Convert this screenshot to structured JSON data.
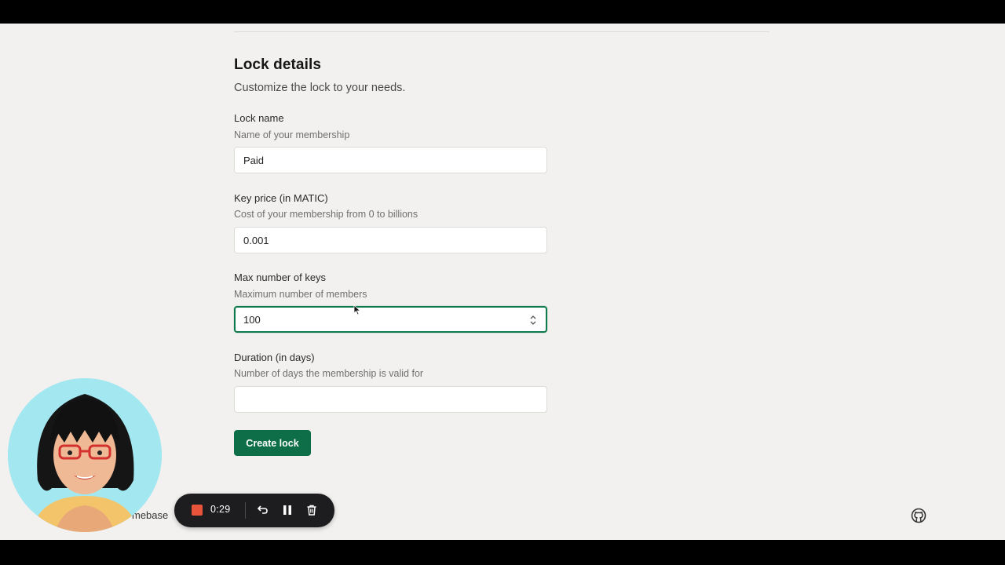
{
  "section": {
    "title": "Lock details",
    "subtitle": "Customize the lock to your needs."
  },
  "fields": {
    "lock_name": {
      "label": "Lock name",
      "help": "Name of your membership",
      "value": "Paid"
    },
    "key_price": {
      "label": "Key price (in MATIC)",
      "help": "Cost of your membership from 0 to billions",
      "value": "0.001"
    },
    "max_keys": {
      "label": "Max number of keys",
      "help": "Maximum number of members",
      "value": "100"
    },
    "duration": {
      "label": "Duration (in days)",
      "help": "Number of days the membership is valid for",
      "value": ""
    }
  },
  "actions": {
    "create_label": "Create lock"
  },
  "footer": {
    "left_text": "mebase"
  },
  "recorder": {
    "time": "0:29",
    "stop_color": "#e8543b"
  },
  "colors": {
    "accent": "#0d6e47",
    "background": "#f2f1ef"
  },
  "icons": {
    "stepper": "stepper-icon",
    "github": "github-icon",
    "undo": "undo-icon",
    "pause": "pause-icon",
    "trash": "trash-icon"
  }
}
